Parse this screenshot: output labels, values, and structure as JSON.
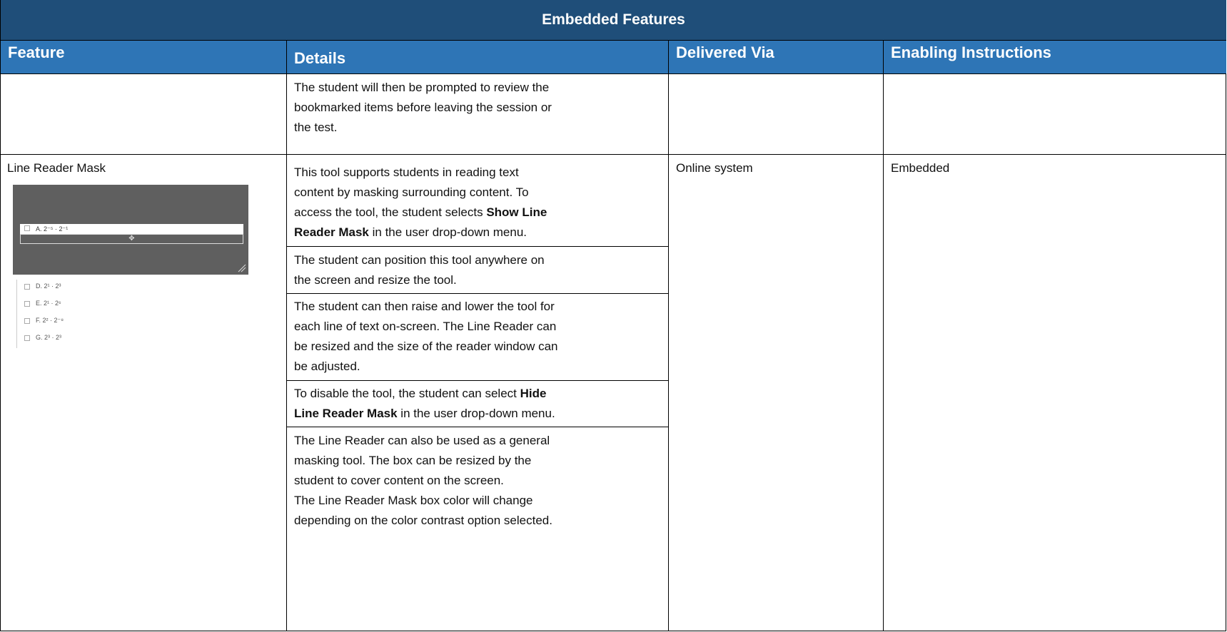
{
  "table": {
    "title": "Embedded Features",
    "headers": {
      "feature": "Feature",
      "details": "Details",
      "delivered": "Delivered Via",
      "enabling": "Enabling Instructions"
    }
  },
  "continuation_row": {
    "details_lines": [
      "The student will then be prompted to review the",
      "bookmarked items before leaving the session or",
      "the  test."
    ]
  },
  "line_reader_row": {
    "feature": "Line Reader Mask",
    "delivered": "Online system",
    "enabling": "Embedded",
    "image": {
      "mask_line_text": "A.  2⁻⁵ · 2⁻¹",
      "move_glyph": "✥",
      "options": [
        "D.  2¹ · 2³",
        "E.  2¹ · 2⁶",
        "F.  2² · 2⁻⁸",
        "G.  2³ · 2³"
      ]
    },
    "p1": {
      "l1": "This tool supports students in reading text",
      "l2": "content by  masking surrounding content. To",
      "l3a": "access the tool, the  student selects ",
      "l3b": "Show Line",
      "l4a": "Reader Mask",
      "l4b": " in the user  drop-down menu."
    },
    "p2": [
      "The student can position this tool anywhere on",
      "the  screen and resize the tool."
    ],
    "p3": [
      "The student can then raise and lower the tool for",
      "each line of text on-screen. The Line Reader can",
      "be  resized and the size of the reader window can",
      "be  adjusted."
    ],
    "p4": {
      "l1a": "To disable the tool, the student can select ",
      "l1b": "Hide",
      "l2a": "Line  Reader Mask",
      "l2b": " in the user drop-down menu."
    },
    "p5": [
      "The Line Reader can also be used as a general",
      "masking tool. The box can be resized by the",
      "student  to cover content on the screen.",
      "The Line Reader Mask box color will change",
      "depending on the color contrast option selected."
    ]
  }
}
